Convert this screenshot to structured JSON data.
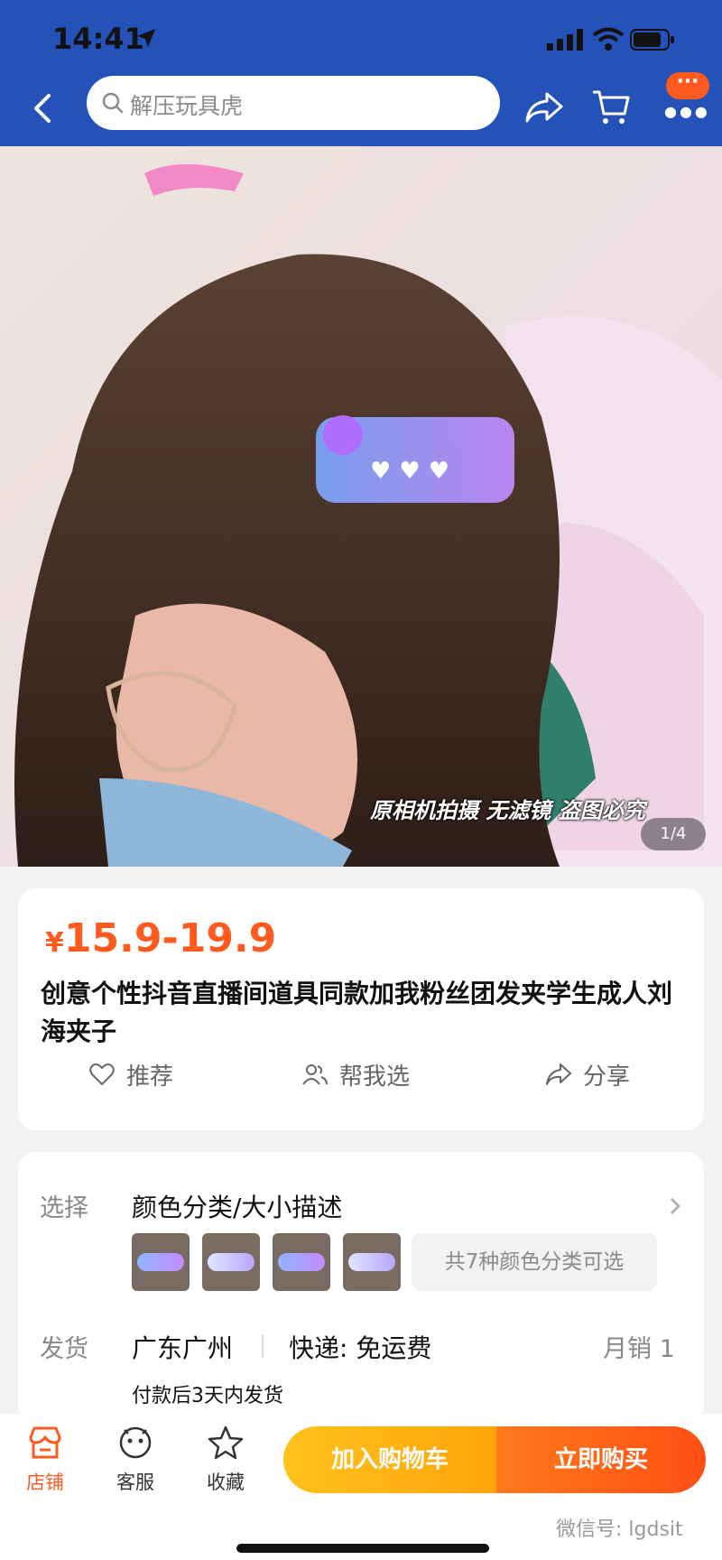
{
  "status_bar": {
    "time": "14:41"
  },
  "nav": {
    "search_placeholder": "解压玩具虎",
    "more_badge": "···"
  },
  "hero": {
    "watermark": "原相机拍摄 无滤镜 盗图必究",
    "page_indicator": "1/4"
  },
  "product": {
    "currency": "¥",
    "price_range": "15.9-19.9",
    "title": "创意个性抖音直播间道具同款加我粉丝团发夹学生成人刘海夹子",
    "actions": {
      "recommend": "推荐",
      "help_choose": "帮我选",
      "share": "分享"
    }
  },
  "sku": {
    "select_label": "选择",
    "select_value": "颜色分类/大小描述",
    "variants_note": "共7种颜色分类可选",
    "ship_label": "发货",
    "ship_location": "广东广州",
    "ship_express": "快递: 免运费",
    "monthly_sales": "月销 1",
    "ship_note": "付款后3天内发货"
  },
  "bottom_bar": {
    "store": "店铺",
    "service": "客服",
    "favorite": "收藏",
    "add_to_cart": "加入购物车",
    "buy_now": "立即购买",
    "wechat": "微信号: lgdsit"
  },
  "colors": {
    "brand_blue": "#2452b8",
    "accent_orange": "#ff5a1f",
    "cart_yellow": "#ffb81a"
  }
}
